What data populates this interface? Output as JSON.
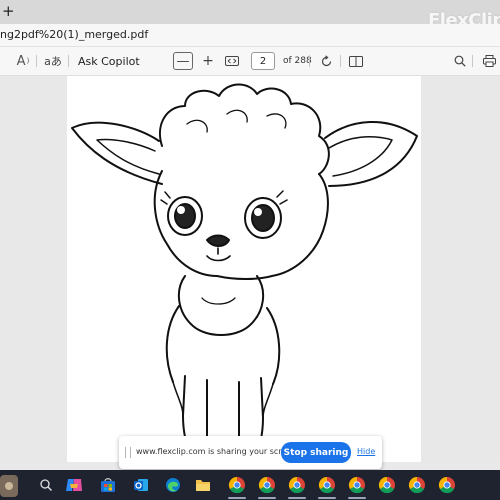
{
  "browser": {
    "new_tab_glyph": "+",
    "watermark": "FlexClip",
    "address_text": "ng2pdf%20(1)_merged.pdf"
  },
  "pdf_toolbar": {
    "read_aloud_glyph": "A",
    "translate_label": "aあ",
    "copilot_label": "Ask Copilot",
    "zoom_out_label": "—",
    "zoom_in_label": "+",
    "page_value": "2",
    "page_of": "of 288"
  },
  "share_bar": {
    "message": "www.flexclip.com is sharing your screen.",
    "stop_label": "Stop sharing",
    "hide_label": "Hide"
  },
  "taskbar": {
    "icons": [
      "weather-icon",
      "search-icon",
      "copilot-icon",
      "store-icon",
      "outlook-icon",
      "edge-icon",
      "file-explorer-icon",
      "chrome-icon",
      "chrome-icon",
      "chrome-icon",
      "chrome-icon",
      "chrome-icon",
      "chrome-icon",
      "chrome-icon",
      "chrome-icon"
    ]
  },
  "colors": {
    "share_button": "#1a73e8",
    "taskbar": "#1f2330"
  }
}
